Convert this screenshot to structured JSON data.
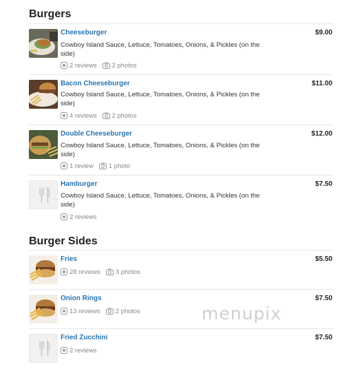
{
  "sections": [
    {
      "title": "Burgers",
      "items": [
        {
          "name": "Cheeseburger",
          "price": "$9.00",
          "description": "Cowboy Island Sauce, Lettuce, Tomatoes, Onions, & Pickles (on the side)",
          "reviews": "2 reviews",
          "photos": "2 photos",
          "image": "burger-photo"
        },
        {
          "name": "Bacon Cheeseburger",
          "price": "$11.00",
          "description": "Cowboy Island Sauce, Lettuce, Tomatoes, Onions, & Pickles (on the side)",
          "reviews": "4 reviews",
          "photos": "2 photos",
          "image": "burger-photo"
        },
        {
          "name": "Double Cheeseburger",
          "price": "$12.00",
          "description": "Cowboy Island Sauce, Lettuce, Tomatoes, Onions, & Pickles (on the side)",
          "reviews": "1 review",
          "photos": "1 photo",
          "image": "burger-photo"
        },
        {
          "name": "Hamburger",
          "price": "$7.50",
          "description": "Cowboy Island Sauce, Lettuce, Tomatoes, Onions, & Pickles (on the side)",
          "reviews": "2 reviews",
          "photos": null,
          "image": "fork-knife-placeholder-icon"
        }
      ]
    },
    {
      "title": "Burger Sides",
      "items": [
        {
          "name": "Fries",
          "price": "$5.50",
          "reviews": "28 reviews",
          "photos": "3 photos",
          "image": "sides-photo"
        },
        {
          "name": "Onion Rings",
          "price": "$7.50",
          "reviews": "13 reviews",
          "photos": "2 photos",
          "image": "sides-photo"
        },
        {
          "name": "Fried Zucchini",
          "price": "$7.50",
          "reviews": "2 reviews",
          "photos": null,
          "image": "fork-knife-placeholder-icon"
        }
      ]
    }
  ],
  "watermark": "menupix",
  "colors": {
    "link": "#2a74b0",
    "meta": "#888888",
    "rule": "#e6e6e6"
  }
}
